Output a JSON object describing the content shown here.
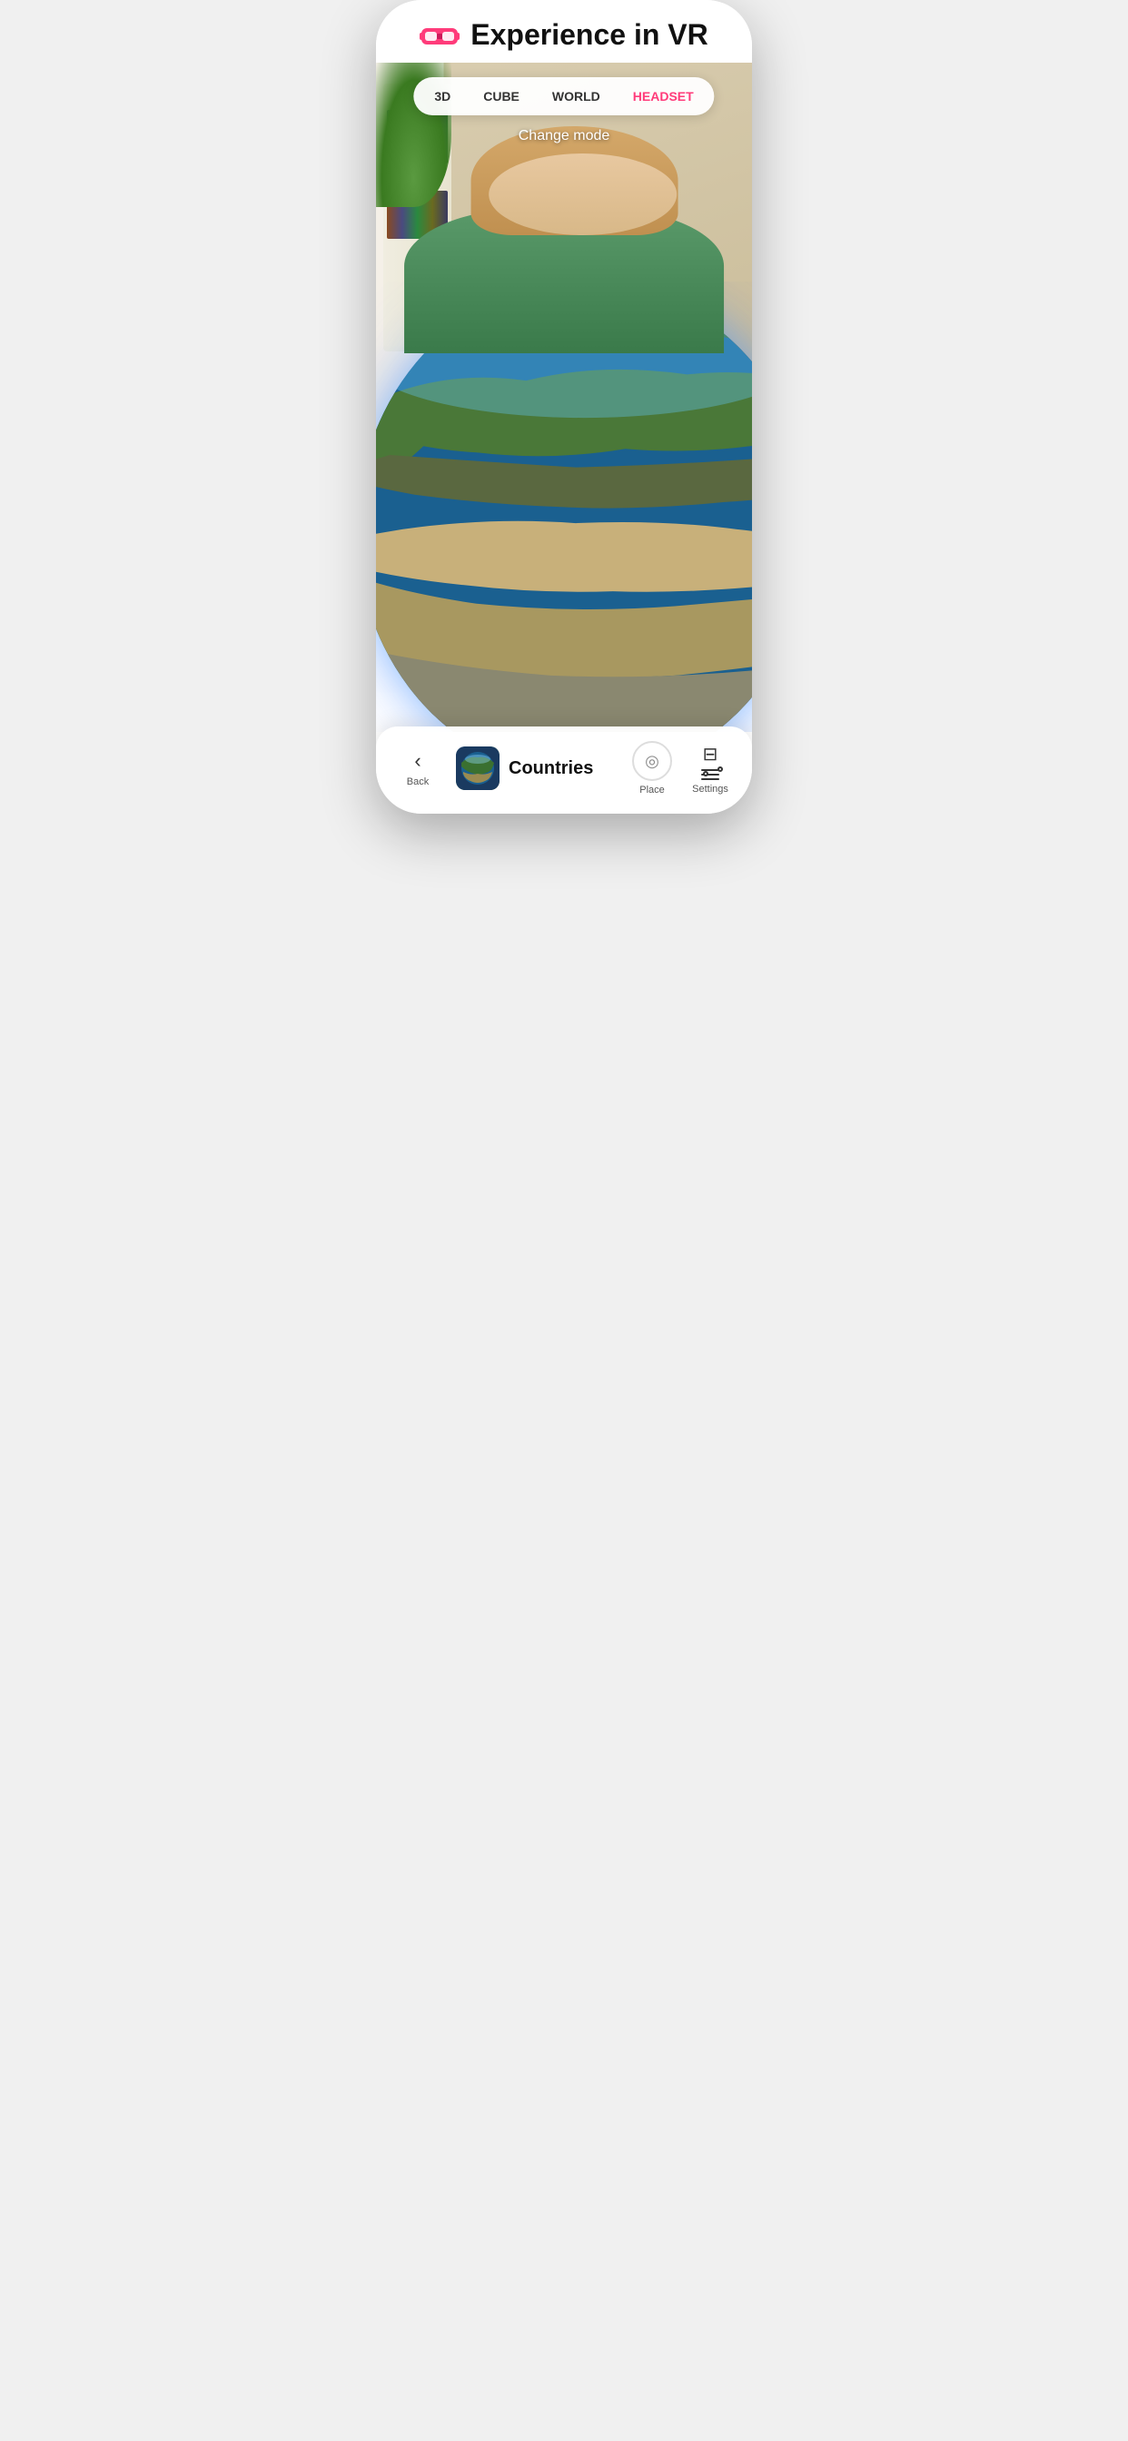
{
  "header": {
    "title": "Experience in VR",
    "vr_icon": "vr-headset-icon"
  },
  "mode_selector": {
    "modes": [
      {
        "label": "3D",
        "active": false
      },
      {
        "label": "CUBE",
        "active": false
      },
      {
        "label": "WORLD",
        "active": false
      },
      {
        "label": "HEADSET",
        "active": true
      }
    ],
    "change_mode_label": "Change mode"
  },
  "content": {
    "item_title": "Countries",
    "item_thumbnail_alt": "countries-globe-thumbnail"
  },
  "bottom_bar": {
    "back_label": "Back",
    "place_label": "Place",
    "settings_label": "Settings"
  }
}
